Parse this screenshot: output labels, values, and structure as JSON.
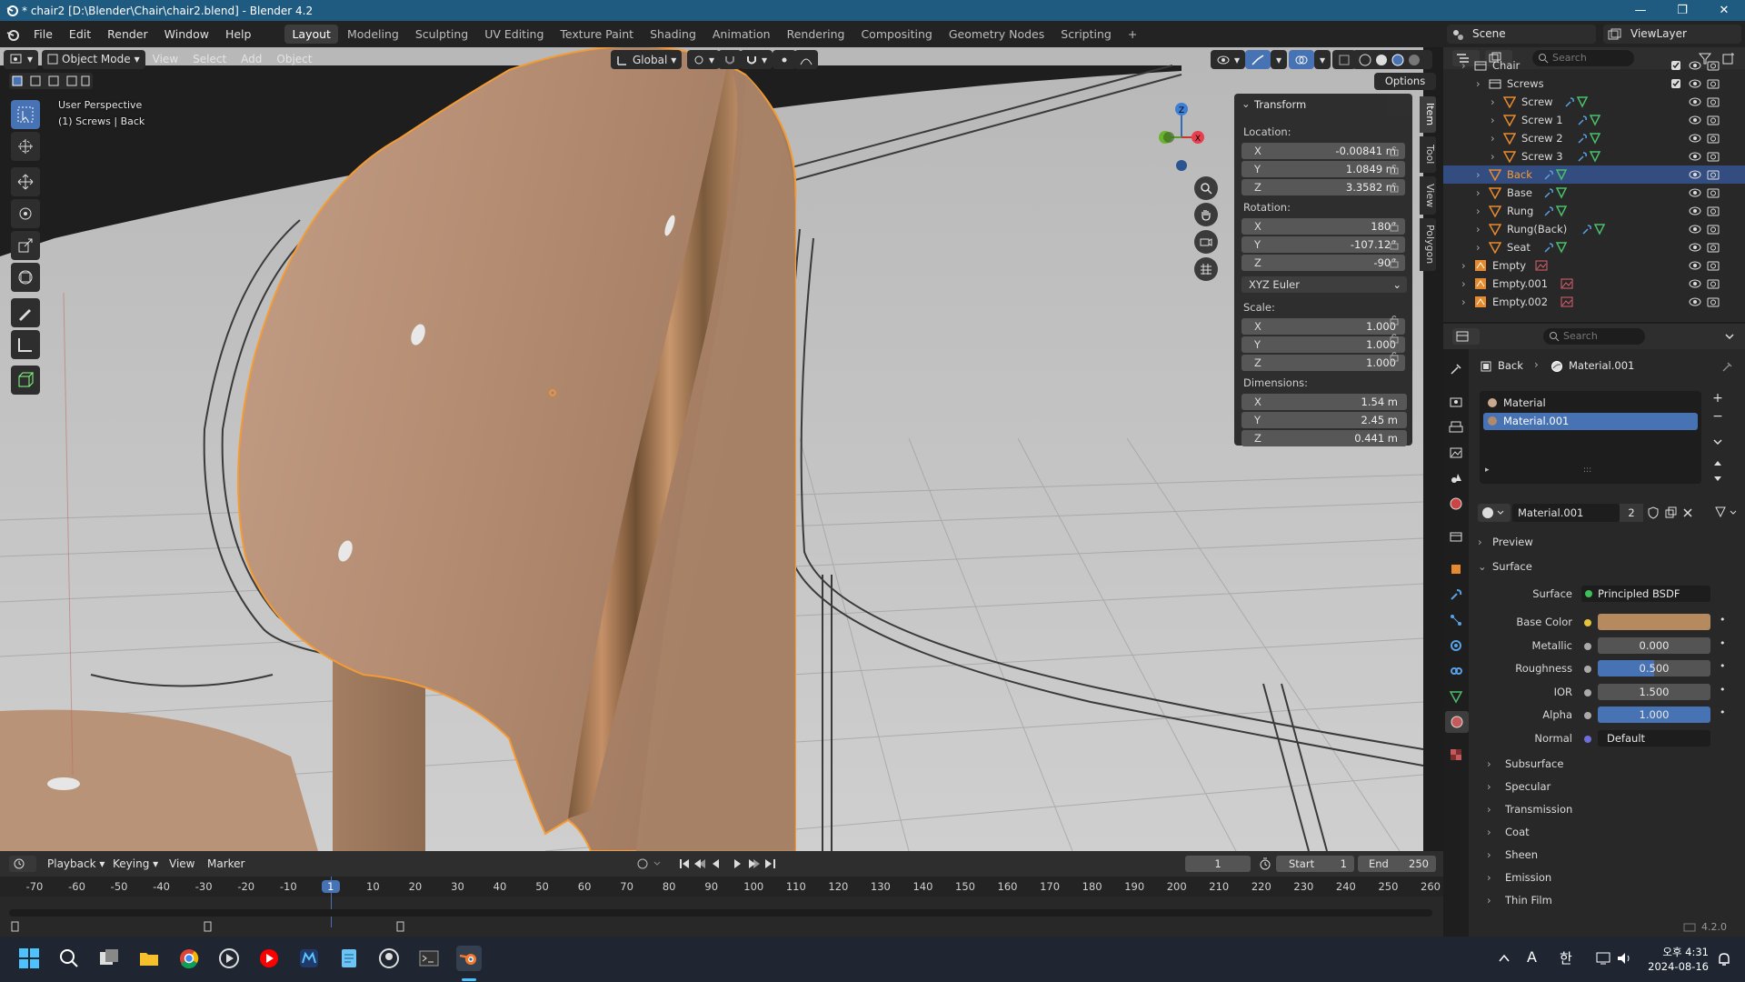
{
  "window": {
    "title": "* chair2 [D:\\Blender\\Chair\\chair2.blend] - Blender 4.2"
  },
  "menu": {
    "items": [
      "File",
      "Edit",
      "Render",
      "Window",
      "Help"
    ]
  },
  "workspaces": [
    "Layout",
    "Modeling",
    "Sculpting",
    "UV Editing",
    "Texture Paint",
    "Shading",
    "Animation",
    "Rendering",
    "Compositing",
    "Geometry Nodes",
    "Scripting"
  ],
  "scene": {
    "label": "Scene",
    "view_layer": "ViewLayer"
  },
  "viewport": {
    "mode": "Object Mode",
    "menus": [
      "View",
      "Select",
      "Add",
      "Object"
    ],
    "transform_orientation": "Global",
    "options_label": "Options",
    "overlay_text_1": "User Perspective",
    "overlay_text_2": "(1) Screws | Back",
    "gizmo": {
      "z": "Z",
      "x": "X",
      "y": "Y"
    }
  },
  "npanel": {
    "header": "Transform",
    "location_label": "Location:",
    "location": [
      {
        "axis": "X",
        "value": "-0.00841 m"
      },
      {
        "axis": "Y",
        "value": "1.0849 m"
      },
      {
        "axis": "Z",
        "value": "3.3582 m"
      }
    ],
    "rotation_label": "Rotation:",
    "rotation": [
      {
        "axis": "X",
        "value": "180°"
      },
      {
        "axis": "Y",
        "value": "-107.12°"
      },
      {
        "axis": "Z",
        "value": "-90°"
      }
    ],
    "rotation_mode": "XYZ Euler",
    "scale_label": "Scale:",
    "scale": [
      {
        "axis": "X",
        "value": "1.000"
      },
      {
        "axis": "Y",
        "value": "1.000"
      },
      {
        "axis": "Z",
        "value": "1.000"
      }
    ],
    "dimensions_label": "Dimensions:",
    "dimensions": [
      {
        "axis": "X",
        "value": "1.54 m"
      },
      {
        "axis": "Y",
        "value": "2.45 m"
      },
      {
        "axis": "Z",
        "value": "0.441 m"
      }
    ],
    "tabs": [
      "Item",
      "Tool",
      "View",
      "Polygon"
    ]
  },
  "outliner": {
    "search_placeholder": "Search",
    "rows": [
      {
        "name": "Chair",
        "level": 1,
        "type": "collection"
      },
      {
        "name": "Screws",
        "level": 2,
        "type": "collection"
      },
      {
        "name": "Screw",
        "level": 3,
        "type": "mesh"
      },
      {
        "name": "Screw 1",
        "level": 3,
        "type": "mesh"
      },
      {
        "name": "Screw 2",
        "level": 3,
        "type": "mesh"
      },
      {
        "name": "Screw 3",
        "level": 3,
        "type": "mesh"
      },
      {
        "name": "Back",
        "level": 2,
        "type": "mesh",
        "selected": true
      },
      {
        "name": "Base",
        "level": 2,
        "type": "mesh"
      },
      {
        "name": "Rung",
        "level": 2,
        "type": "mesh"
      },
      {
        "name": "Rung(Back)",
        "level": 2,
        "type": "mesh"
      },
      {
        "name": "Seat",
        "level": 2,
        "type": "mesh"
      },
      {
        "name": "Empty",
        "level": 1,
        "type": "empty"
      },
      {
        "name": "Empty.001",
        "level": 1,
        "type": "empty"
      },
      {
        "name": "Empty.002",
        "level": 1,
        "type": "empty"
      }
    ]
  },
  "properties": {
    "search_placeholder": "Search",
    "breadcrumb_object": "Back",
    "breadcrumb_material": "Material.001",
    "slots": [
      "Material",
      "Material.001"
    ],
    "material_name": "Material.001",
    "user_count": "2",
    "preview_label": "Preview",
    "surface_section": "Surface",
    "surface_label": "Surface",
    "surface_value": "Principled BSDF",
    "fields": [
      {
        "label": "Base Color",
        "value": "",
        "color": "#b58a5e"
      },
      {
        "label": "Metallic",
        "value": "0.000",
        "fill": 0.0
      },
      {
        "label": "Roughness",
        "value": "0.500",
        "fill": 0.5
      },
      {
        "label": "IOR",
        "value": "1.500",
        "fill": 0.0
      },
      {
        "label": "Alpha",
        "value": "1.000",
        "fill": 1.0
      },
      {
        "label": "Normal",
        "value": "Default"
      }
    ],
    "subsections": [
      "Subsurface",
      "Specular",
      "Transmission",
      "Coat",
      "Sheen",
      "Emission",
      "Thin Film"
    ]
  },
  "timeline": {
    "menus": [
      "Playback",
      "Keying",
      "View",
      "Marker"
    ],
    "current_frame": "1",
    "start_label": "Start",
    "start": "1",
    "end_label": "End",
    "end": "250",
    "ticks": [
      "-70",
      "-60",
      "-50",
      "-40",
      "-30",
      "-20",
      "-10",
      "1",
      "10",
      "20",
      "30",
      "40",
      "50",
      "60",
      "70",
      "80",
      "90",
      "100",
      "110",
      "120",
      "130",
      "140",
      "150",
      "160",
      "170",
      "180",
      "190",
      "200",
      "210",
      "220",
      "230",
      "240",
      "250",
      "260"
    ]
  },
  "statusbar": {
    "version": "4.2.0"
  },
  "taskbar": {
    "ime": "A",
    "ime2": "한",
    "time": "오후 4:31",
    "date": "2024-08-16"
  },
  "colors": {
    "accent": "#4772b3",
    "selection": "#f39b35",
    "title": "#1f5a80"
  }
}
